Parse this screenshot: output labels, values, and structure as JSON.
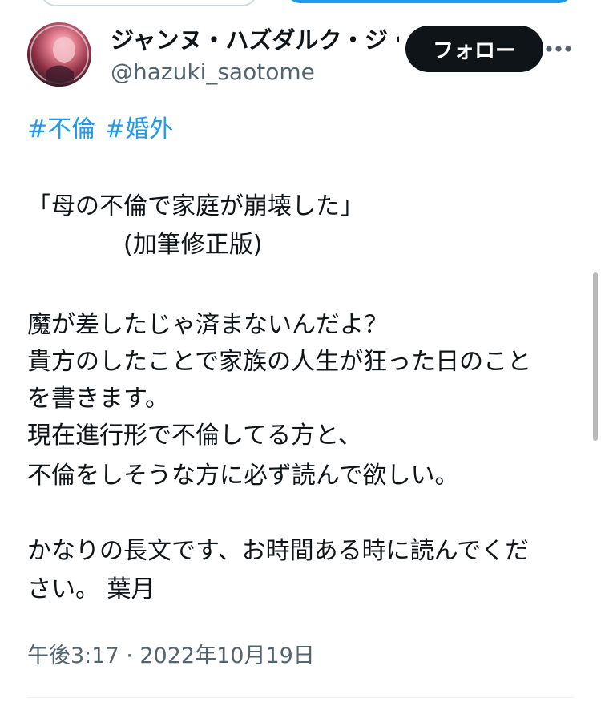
{
  "top_actions": {
    "left_pill": "",
    "right_pill": ""
  },
  "header": {
    "display_name": "ジャンヌ・ハズダルク・ジ・",
    "handle": "@hazuki_saotome",
    "follow_label": "フォロー",
    "more_icon": "more-horizontal-icon"
  },
  "tweet": {
    "hashtags": [
      "#不倫",
      "#婚外"
    ],
    "lines": [
      "「母の不倫で家庭が崩壊した」",
      "　　　　(加筆修正版)",
      "魔が差したじゃ済まないんだよ？",
      "貴方のしたことで家族の人生が狂った日のこと",
      "を書きます。",
      "現在進行形で不倫してる方と、",
      "不倫をしそうな方に必ず読んで欲しい。",
      "かなりの長文です、お時間ある時に読んでくだ",
      "さい。 葉月"
    ],
    "timestamp": "午後3:17 · 2022年10月19日"
  },
  "colors": {
    "link": "#1d9bf0",
    "text": "#0f1419",
    "secondary": "#536471",
    "follow_bg": "#0f1419"
  }
}
